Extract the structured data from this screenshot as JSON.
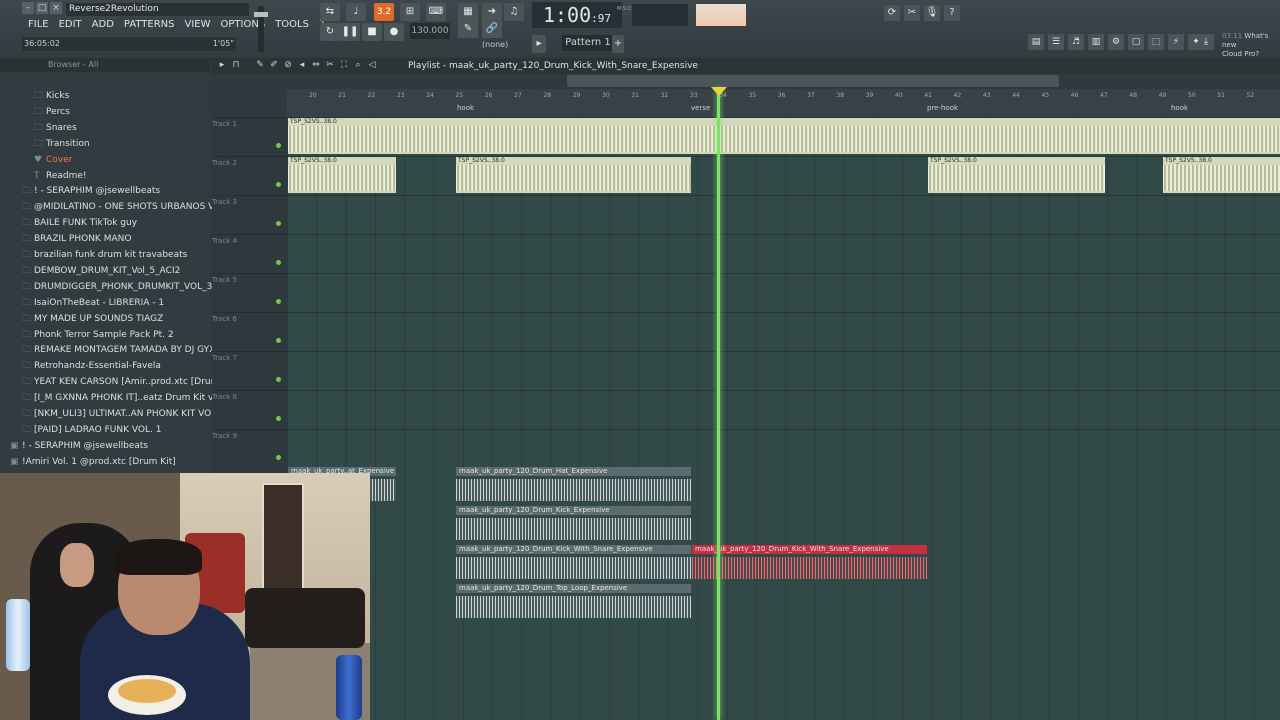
{
  "window": {
    "project_title": "Reverse2Revolution",
    "hint_left": "36:05:02",
    "hint_right": "1'05\""
  },
  "menu": [
    "FILE",
    "EDIT",
    "ADD",
    "PATTERNS",
    "VIEW",
    "OPTIONS",
    "TOOLS",
    "?"
  ],
  "transport": {
    "time_main": "1:00",
    "time_sub": ":97",
    "time_unit": "M:S:CS",
    "tempo": "130.000",
    "record_mode_label": "3.2",
    "pattern": "Pattern 1",
    "snap": "(none)"
  },
  "news": {
    "line1": "03:11",
    "line2": "What's new",
    "line3": "Cloud Pro?"
  },
  "browser": {
    "header": "Browser - All",
    "items": [
      {
        "label": "Kicks",
        "icon": "folder",
        "indent": 2
      },
      {
        "label": "Percs",
        "icon": "folder",
        "indent": 2
      },
      {
        "label": "Snares",
        "icon": "folder",
        "indent": 2
      },
      {
        "label": "Transition",
        "icon": "folder",
        "indent": 2
      },
      {
        "label": "Cover",
        "icon": "heart",
        "indent": 2
      },
      {
        "label": "Readme!",
        "icon": "text",
        "indent": 2
      },
      {
        "label": "! - SERAPHIM @jsewellbeats",
        "icon": "folder",
        "indent": 1
      },
      {
        "label": "@MIDILATINO - ONE SHOTS URBANOS VOL. 2",
        "icon": "folder",
        "indent": 1
      },
      {
        "label": "BAILE FUNK TikTok guy",
        "icon": "folder",
        "indent": 1
      },
      {
        "label": "BRAZIL PHONK MANO",
        "icon": "folder",
        "indent": 1
      },
      {
        "label": "brazilian funk drum kit travabeats",
        "icon": "folder",
        "indent": 1
      },
      {
        "label": "DEMBOW_DRUM_KIT_Vol_5_ACI2",
        "icon": "folder",
        "indent": 1
      },
      {
        "label": "DRUMDIGGER_PHONK_DRUMKIT_VOL_3",
        "icon": "folder",
        "indent": 1
      },
      {
        "label": "IsaiOnTheBeat - LIBRERIA - 1",
        "icon": "folder",
        "indent": 1
      },
      {
        "label": "MY MADE UP SOUNDS TIAGZ",
        "icon": "folder",
        "indent": 1
      },
      {
        "label": "Phonk Terror Sample Pack Pt. 2",
        "icon": "folder",
        "indent": 1
      },
      {
        "label": "REMAKE MONTAGEM TAMADA BY DJ GYX",
        "icon": "folder",
        "indent": 1
      },
      {
        "label": "Retrohandz-Essential-Favela",
        "icon": "folder",
        "indent": 1
      },
      {
        "label": "YEAT KEN CARSON [Amir..prod.xtc [Drum Kit]",
        "icon": "folder",
        "indent": 1
      },
      {
        "label": "[I_M GXNNA PHONK IT]..eatz Drum Kit vol 1",
        "icon": "folder",
        "indent": 1
      },
      {
        "label": "[NKM_ULI3] ULTIMAT..AN PHONK KIT VOL. 3",
        "icon": "folder",
        "indent": 1
      },
      {
        "label": "[PAID] LADRAO FUNK VOL. 1",
        "icon": "folder",
        "indent": 1
      },
      {
        "label": "! - SERAPHIM @jsewellbeats",
        "icon": "pack",
        "indent": 0
      },
      {
        "label": "!Amiri Vol. 1 @prod.xtc [Drum Kit]",
        "icon": "pack",
        "indent": 0
      }
    ]
  },
  "playlist": {
    "title": "Playlist - maak_uk_party_120_Drum_Kick_With_Snare_Expensive",
    "bars": [
      "20",
      "21",
      "22",
      "23",
      "24",
      "25",
      "26",
      "27",
      "28",
      "29",
      "30",
      "31",
      "32",
      "33",
      "34",
      "35",
      "36",
      "37",
      "38",
      "39",
      "40",
      "41",
      "42",
      "43",
      "44",
      "45",
      "46",
      "47",
      "48",
      "49",
      "50",
      "51",
      "52"
    ],
    "markers": [
      "hook",
      "verse",
      "pre-hook",
      "hook"
    ],
    "tracks": [
      "Track 1",
      "Track 2",
      "Track 3",
      "Track 4",
      "Track 5",
      "Track 6",
      "Track 7",
      "Track 8",
      "Track 9"
    ],
    "pattern_clip_label": "TSP_S2VS..38.0",
    "audio_clips": [
      "maak_uk_party..at_Expensive",
      "maak_uk_party_120_Drum_Hat_Expensive",
      "maak_uk_party_120_Drum_Kick_Expensive",
      "maak_uk_party_120_Drum_Kick_With_Snare_Expensive",
      "maak_uk_party_120_Drum_Kick_With_Snare_Expensive",
      "maak_uk_party_120_Drum_Top_Loop_Expensive"
    ]
  },
  "colors": {
    "accent": "#e06a2c",
    "playhead": "#7fe06a",
    "selected_clip": "#c43040",
    "grid": "#324a47"
  }
}
